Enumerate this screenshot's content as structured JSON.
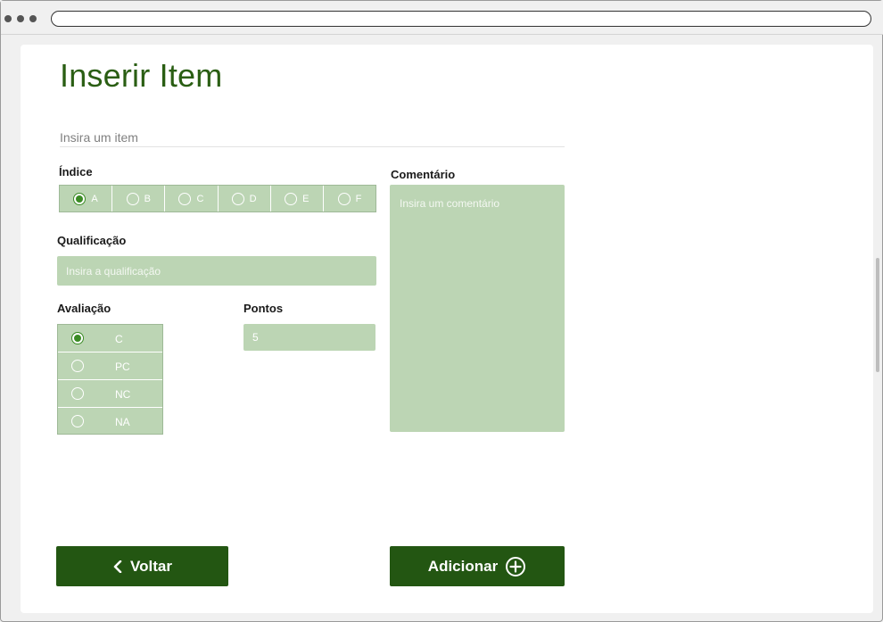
{
  "browser": {
    "url": ""
  },
  "page": {
    "title": "Inserir Item"
  },
  "item": {
    "placeholder": "Insira um item",
    "value": ""
  },
  "indice": {
    "label": "Índice",
    "options": [
      "A",
      "B",
      "C",
      "D",
      "E",
      "F"
    ],
    "selected": "A"
  },
  "qualificacao": {
    "label": "Qualificação",
    "placeholder": "Insira a qualificação",
    "value": ""
  },
  "avaliacao": {
    "label": "Avaliação",
    "options": [
      "C",
      "PC",
      "NC",
      "NA"
    ],
    "selected": "C"
  },
  "pontos": {
    "label": "Pontos",
    "value": "5"
  },
  "comentario": {
    "label": "Comentário",
    "placeholder": "Insira um comentário",
    "value": ""
  },
  "buttons": {
    "back": "Voltar",
    "add": "Adicionar"
  },
  "icons": {
    "back": "chevron-left-icon",
    "add": "plus-circle-icon"
  },
  "colors": {
    "accent": "#235612",
    "title": "#2a5e13",
    "field": "#bcd5b4",
    "radio_selected": "#3b8b25"
  }
}
